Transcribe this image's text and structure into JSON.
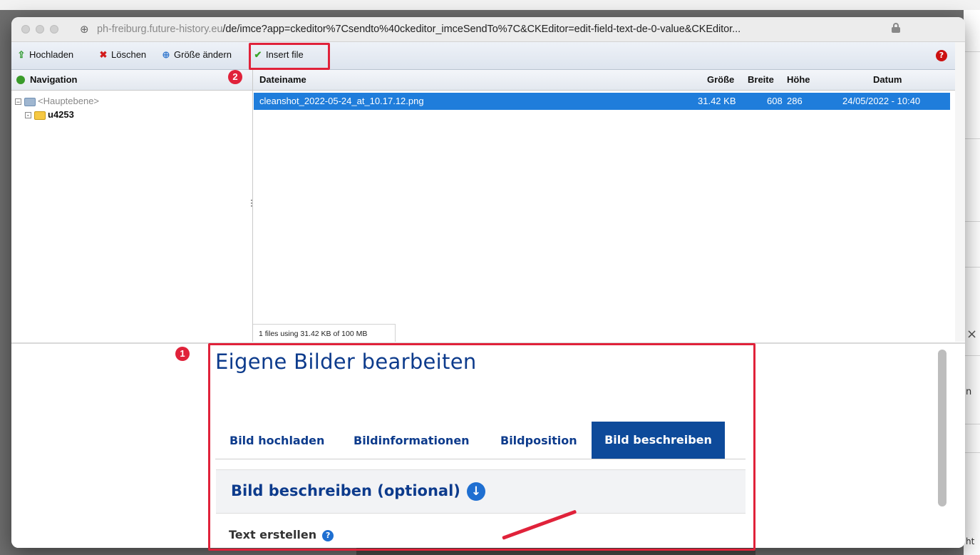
{
  "browser": {
    "url_host": "ph-freiburg.future-history.eu",
    "url_path": "/de/imce?app=ckeditor%7Csendto%40ckeditor_imceSendTo%7C&CKEditor=edit-field-text-de-0-value&CKEditor..."
  },
  "toolbar": {
    "upload_label": "Hochladen",
    "delete_label": "Löschen",
    "resize_label": "Größe ändern",
    "insert_label": "Insert file",
    "help_label": "?"
  },
  "navigation": {
    "header": "Navigation",
    "root": "<Hauptebene>",
    "folder": "u4253"
  },
  "filelist": {
    "columns": {
      "name": "Dateiname",
      "size": "Größe",
      "width": "Breite",
      "height": "Höhe",
      "date": "Datum"
    },
    "rows": [
      {
        "name": "cleanshot_2022-05-24_at_10.17.12.png",
        "size": "31.42 KB",
        "width": "608",
        "height": "286",
        "date": "24/05/2022 - 10:40"
      }
    ],
    "status": "1 files using 31.42 KB of 100 MB"
  },
  "annotations": {
    "badge1": "1",
    "badge2": "2",
    "accent_color": "#e0223a"
  },
  "cms": {
    "title": "Eigene Bilder bearbeiten",
    "tabs": [
      "Bild hochladen",
      "Bildinformationen",
      "Bildposition",
      "Bild beschreiben"
    ],
    "active_tab": 3,
    "section_title": "Bild beschreiben (optional)",
    "subsection": "Text erstellen",
    "subsection_help": "?"
  },
  "background": {
    "right_fragment_n": "n",
    "right_fragment_ht": "ht",
    "close_glyph": "×"
  }
}
